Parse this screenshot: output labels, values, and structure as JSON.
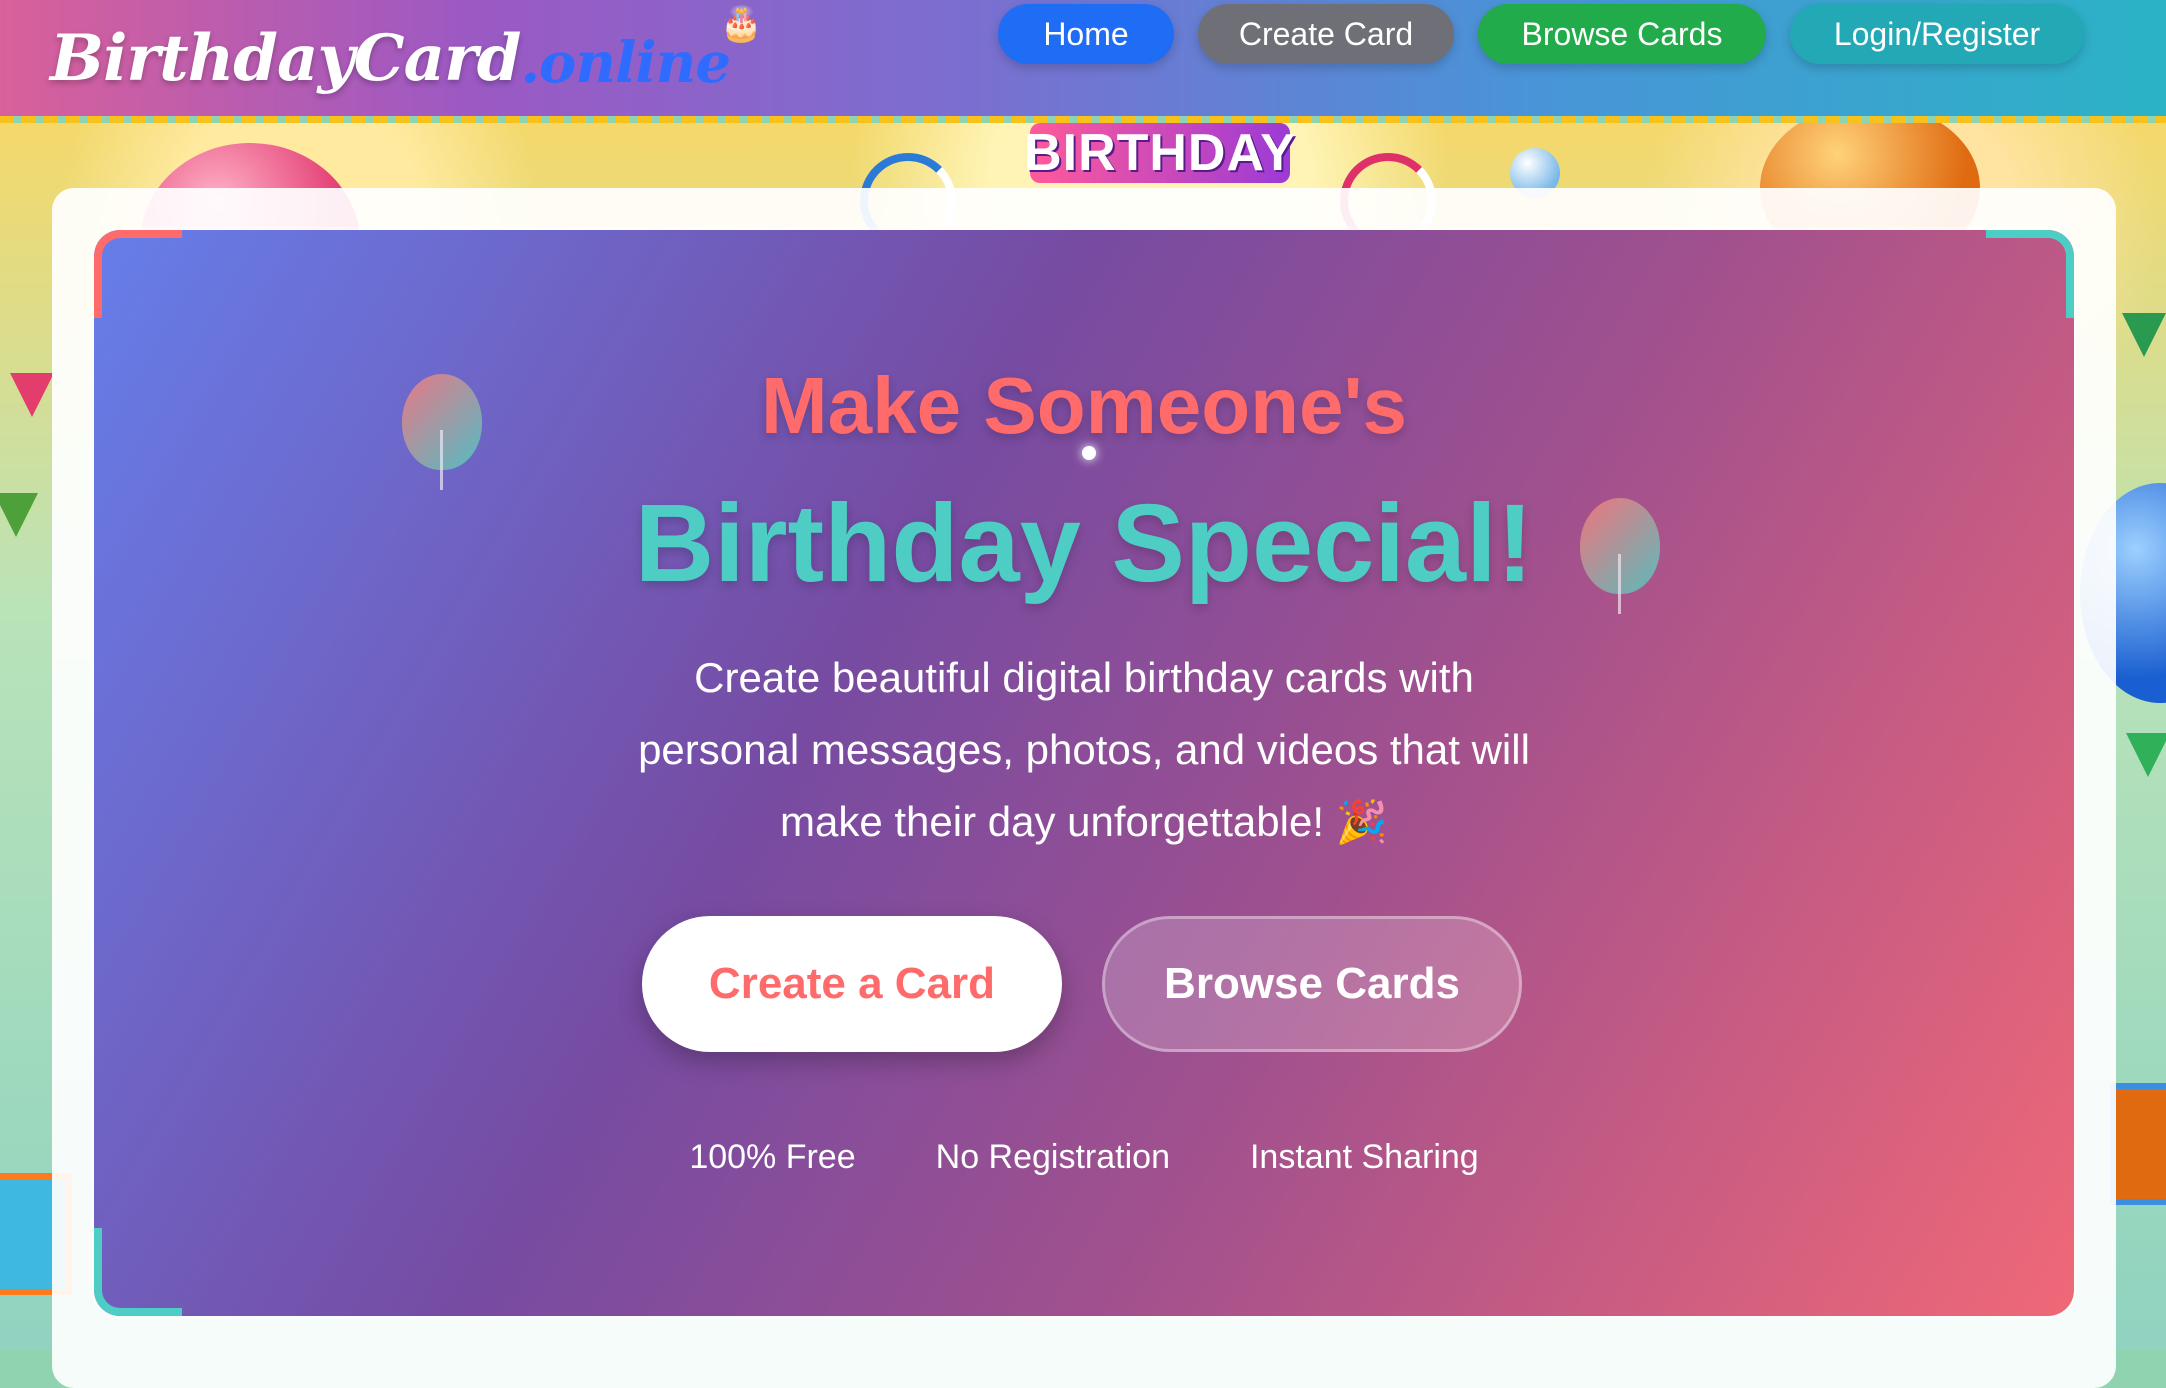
{
  "header": {
    "logo": {
      "main": "BirthdayCard",
      "accent": ".online",
      "cake": "🎂"
    },
    "nav": [
      {
        "label": "Home",
        "color": "#1f6cf5"
      },
      {
        "label": "Create Card",
        "color": "#6f6f78"
      },
      {
        "label": "Browse Cards",
        "color": "#22ab4a"
      },
      {
        "label": "Login/Register",
        "color": "#23a8b6"
      }
    ]
  },
  "background": {
    "banner_text": "BIRTHDAY"
  },
  "hero": {
    "headline_line1": "Make Someone's",
    "headline_line2": "Birthday Special!",
    "subtitle": "Create beautiful digital birthday cards with personal messages, photos, and videos that will make their day unforgettable! 🎉",
    "buttons": {
      "create": "Create a Card",
      "browse": "Browse Cards"
    },
    "features": [
      "100% Free",
      "No Registration",
      "Instant Sharing"
    ],
    "colors": {
      "headline1": "#ff6b6b",
      "headline2": "#4ecdc4",
      "gradient_start": "#667eea",
      "gradient_end": "#f06877"
    }
  }
}
